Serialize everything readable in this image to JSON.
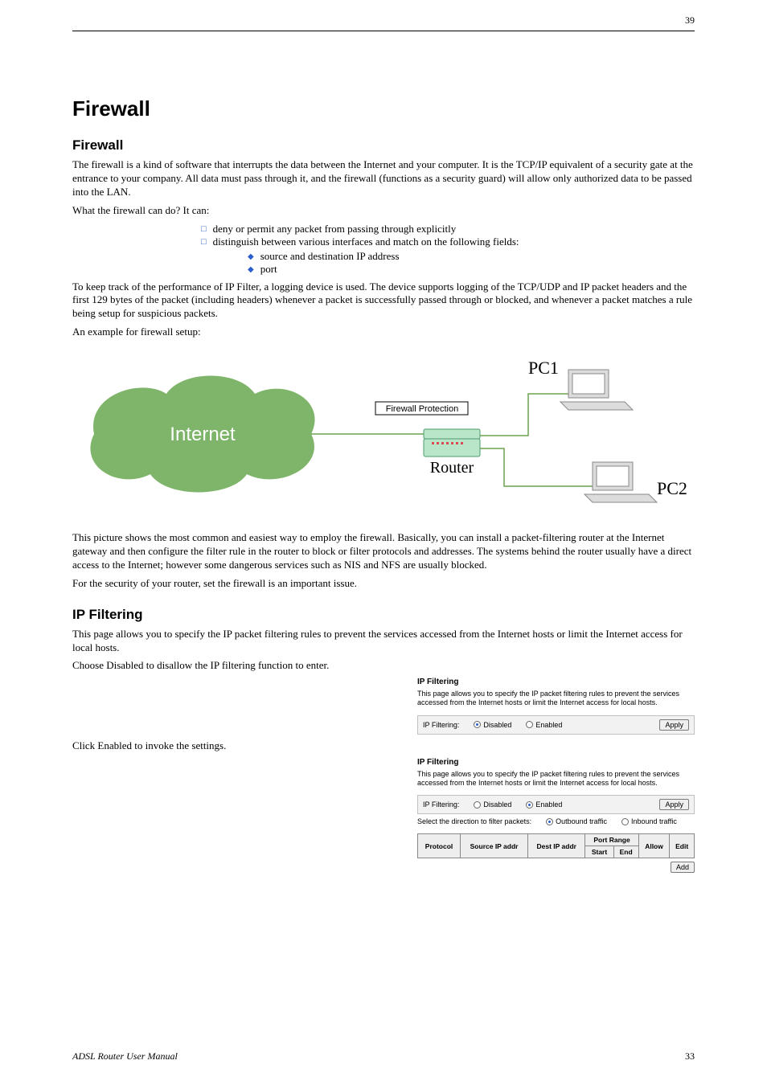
{
  "header": {
    "page_top": "39",
    "footer_left": "ADSL Router User Manual",
    "page_bot": "33"
  },
  "title": "Firewall",
  "intro_heading": "Firewall",
  "intro_text": "The firewall is a kind of software that interrupts the data between the Internet and your computer. It is the TCP/IP equivalent of a security gate at the entrance to your company. All data must pass through it, and the firewall (functions as a security guard) will allow only authorized data to be passed into the LAN.",
  "intro_text2": "What the firewall can do? It can:",
  "bullets_sq": {
    "b1": "deny or permit any packet from passing through explicitly",
    "b2": "distinguish between various interfaces and match on the following fields:",
    "b2a": "source and destination IP address",
    "b2b": "port"
  },
  "intro_text3": "To keep track of the performance of IP Filter, a logging device is used. The device supports logging of the TCP/UDP and IP packet headers and the first 129 bytes of the packet (including headers) whenever a packet is successfully passed through or blocked, and whenever a packet matches a rule being setup for suspicious packets.",
  "intro_text4": "An example for firewall setup:",
  "diagram": {
    "internet": "Internet",
    "fw_label": "Firewall Protection",
    "router": "Router",
    "pc1": "PC1",
    "pc2": "PC2"
  },
  "diagram_text": "This picture shows the most common and easiest way to employ the firewall. Basically, you can install a packet-filtering router at the Internet gateway and then configure the filter rule in the router to block or filter protocols and addresses. The systems behind the router usually have a direct access to the Internet; however some dangerous services such as NIS and NFS are usually blocked.",
  "diagram_text2": "For the security of your router, set the firewall is an important issue.",
  "ipfilter": {
    "heading": "IP Filtering",
    "body": "This page allows you to specify the IP packet filtering rules to prevent the services accessed from the Internet hosts or limit the Internet access for local hosts.",
    "disabled_txt": "Choose Disabled to disallow the IP filtering function to enter.",
    "panel_title": "IP Filtering",
    "panel_desc": "This page allows you to specify the IP packet filtering rules to prevent the services accessed from the Internet hosts or limit the Internet access for local hosts.",
    "label_ipf": "IP Filtering:",
    "opt_disabled": "Disabled",
    "opt_enabled": "Enabled",
    "btn_apply": "Apply",
    "enabled_txt": "Click Enabled to invoke the settings.",
    "dir_label": "Select the direction to filter packets:",
    "dir_out": "Outbound traffic",
    "dir_in": "Inbound traffic",
    "th_proto": "Protocol",
    "th_src": "Source IP addr",
    "th_dst": "Dest IP addr",
    "th_port": "Port Range",
    "th_start": "Start",
    "th_end": "End",
    "th_allow": "Allow",
    "th_edit": "Edit",
    "btn_add": "Add"
  }
}
